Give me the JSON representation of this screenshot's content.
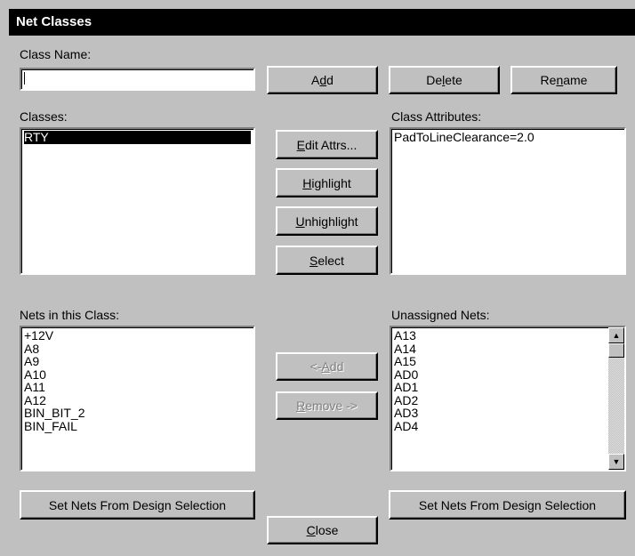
{
  "window": {
    "title": "Net Classes"
  },
  "class_name": {
    "label": "Class Name:",
    "value": ""
  },
  "buttons": {
    "add_pre": "A",
    "add_key": "d",
    "add_post": "d",
    "delete_pre": "De",
    "delete_key": "l",
    "delete_post": "ete",
    "rename_pre": "Re",
    "rename_key": "n",
    "rename_post": "ame",
    "edit_attrs_key": "E",
    "edit_attrs_post": "dit Attrs...",
    "highlight_key": "H",
    "highlight_post": "ighlight",
    "unhighlight_key": "U",
    "unhighlight_post": "nhighlight",
    "select_key": "S",
    "select_post": "elect",
    "add_net_pre": "<- ",
    "add_net_key": "A",
    "add_net_post": "dd",
    "remove_net_key": "R",
    "remove_net_post": "emove ->",
    "close_key": "C",
    "close_post": "lose",
    "set_nets_left": "Set Nets From Design Selection",
    "set_nets_right": "Set Nets From Design Selection"
  },
  "classes": {
    "label": "Classes:",
    "items": [
      "RTY"
    ],
    "selected": "RTY"
  },
  "class_attributes": {
    "label": "Class Attributes:",
    "items": [
      "PadToLineClearance=2.0"
    ]
  },
  "nets_in_class": {
    "label": "Nets in this Class:",
    "items": [
      "+12V",
      "A8",
      "A9",
      "A10",
      "A11",
      "A12",
      "BIN_BIT_2",
      "BIN_FAIL"
    ]
  },
  "unassigned_nets": {
    "label": "Unassigned Nets:",
    "items": [
      "A13",
      "A14",
      "A15",
      "AD0",
      "AD1",
      "AD2",
      "AD3",
      "AD4"
    ]
  },
  "icons": {
    "scroll_up": "▲",
    "scroll_down": "▼"
  }
}
